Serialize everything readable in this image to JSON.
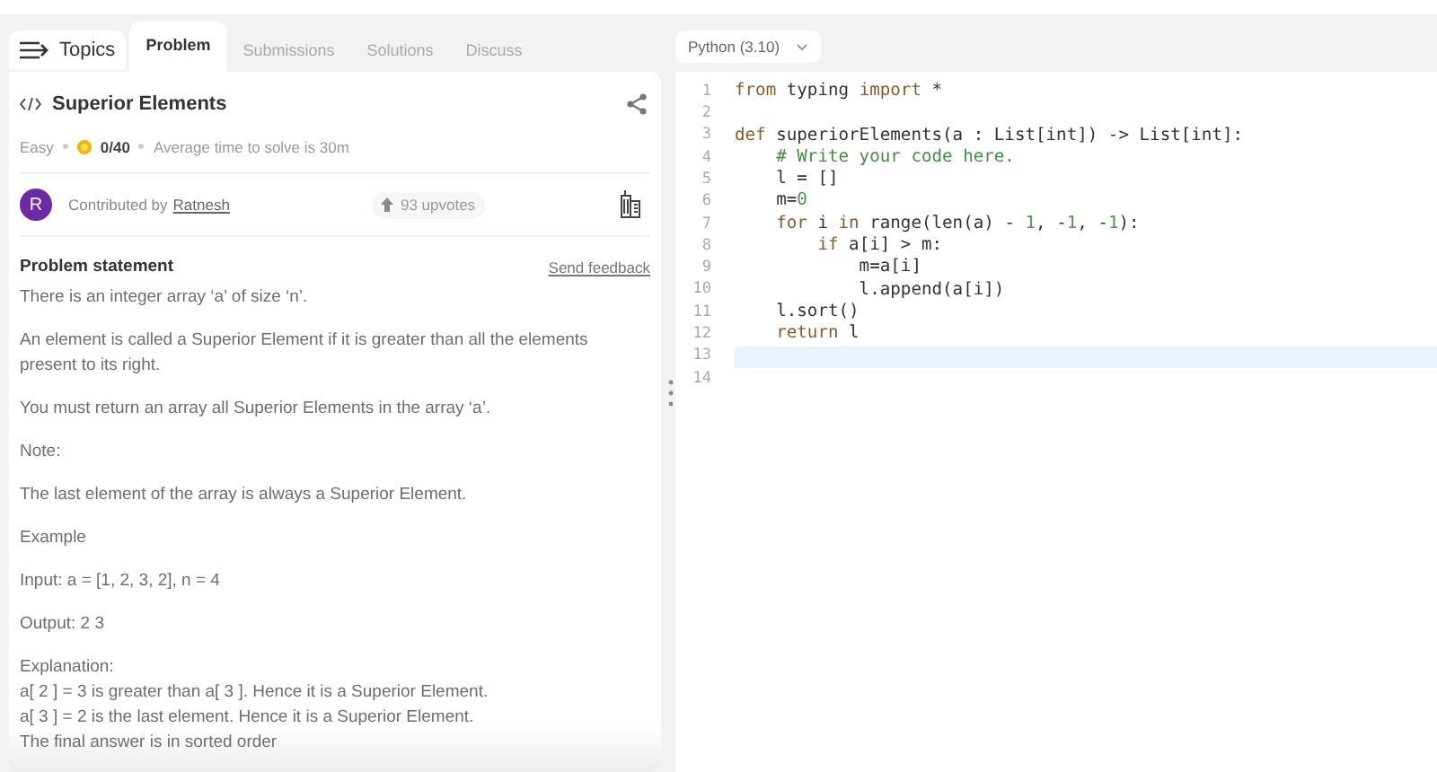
{
  "topics_button": {
    "label": "Topics"
  },
  "tabs": [
    {
      "label": "Problem",
      "selected": true
    },
    {
      "label": "Submissions",
      "selected": false
    },
    {
      "label": "Solutions",
      "selected": false
    },
    {
      "label": "Discuss",
      "selected": false
    }
  ],
  "problem": {
    "title": "Superior Elements",
    "difficulty": "Easy",
    "score": "0/40",
    "average_time": "Average time to solve is 30m",
    "contributor": {
      "avatar_letter": "R",
      "prefix": "Contributed by",
      "name": "Ratnesh"
    },
    "upvotes": "93 upvotes",
    "statement_heading": "Problem statement",
    "feedback_link": "Send feedback",
    "blocks": [
      [
        "There is an integer array ‘a’ of size ‘n’."
      ],
      [
        "An element is called a Superior Element if it is greater than all the elements present to its right."
      ],
      [
        "You must return an array all Superior Elements in the array ‘a’."
      ],
      [
        "Note:"
      ],
      [
        "The last element of the array is always a Superior Element."
      ],
      [
        "Example"
      ],
      [
        "Input: a = [1, 2, 3, 2], n = 4"
      ],
      [
        "Output: 2 3"
      ],
      [
        "Explanation:",
        "a[ 2 ] = 3 is greater than a[ 3 ]. Hence it is a Superior Element.",
        "a[ 3 ] = 2 is the last element. Hence it is a Superior Element.",
        "The final answer is in sorted order"
      ]
    ]
  },
  "language": "Python (3.10)",
  "editor": {
    "lines": [
      {
        "number": "1",
        "active": false,
        "tokens": [
          {
            "t": "from",
            "kind": "keyword"
          },
          {
            "t": " typing ",
            "kind": "plain"
          },
          {
            "t": "import",
            "kind": "keyword"
          },
          {
            "t": " *",
            "kind": "plain"
          }
        ]
      },
      {
        "number": "2",
        "active": false
      },
      {
        "number": "3",
        "active": false,
        "tokens": [
          {
            "t": "def",
            "kind": "keyword"
          },
          {
            "t": " superiorElements(a : List[int]) -> List[int]:",
            "kind": "plain"
          }
        ]
      },
      {
        "number": "4",
        "active": false,
        "tokens": [
          {
            "t": "    # Write your code here.",
            "kind": "comment"
          }
        ]
      },
      {
        "number": "5",
        "active": false,
        "tokens": [
          {
            "t": "    l = []",
            "kind": "plain"
          }
        ]
      },
      {
        "number": "6",
        "active": false,
        "tokens": [
          {
            "t": "    m=",
            "kind": "plain"
          },
          {
            "t": "0",
            "kind": "number"
          }
        ]
      },
      {
        "number": "7",
        "active": false,
        "tokens": [
          {
            "t": "    for",
            "kind": "keyword"
          },
          {
            "t": " i ",
            "kind": "plain"
          },
          {
            "t": "in",
            "kind": "keyword"
          },
          {
            "t": " range(len(a) - ",
            "kind": "plain"
          },
          {
            "t": "1",
            "kind": "number"
          },
          {
            "t": ", -",
            "kind": "plain"
          },
          {
            "t": "1",
            "kind": "number"
          },
          {
            "t": ", -",
            "kind": "plain"
          },
          {
            "t": "1",
            "kind": "number"
          },
          {
            "t": "):",
            "kind": "plain"
          }
        ]
      },
      {
        "number": "8",
        "active": false,
        "tokens": [
          {
            "t": "        if",
            "kind": "keyword"
          },
          {
            "t": " a[i] > m:",
            "kind": "plain"
          }
        ]
      },
      {
        "number": "9",
        "active": false,
        "tokens": [
          {
            "t": "            m=a[i]",
            "kind": "plain"
          }
        ]
      },
      {
        "number": "10",
        "active": false,
        "tokens": [
          {
            "t": "            l.append(a[i])",
            "kind": "plain"
          }
        ]
      },
      {
        "number": "11",
        "active": false,
        "tokens": [
          {
            "t": "    l.sort()",
            "kind": "plain"
          }
        ]
      },
      {
        "number": "12",
        "active": false,
        "tokens": [
          {
            "t": "    return",
            "kind": "keyword"
          },
          {
            "t": " l",
            "kind": "plain"
          }
        ]
      },
      {
        "number": "13",
        "active": true
      },
      {
        "number": "14",
        "active": false
      }
    ]
  }
}
